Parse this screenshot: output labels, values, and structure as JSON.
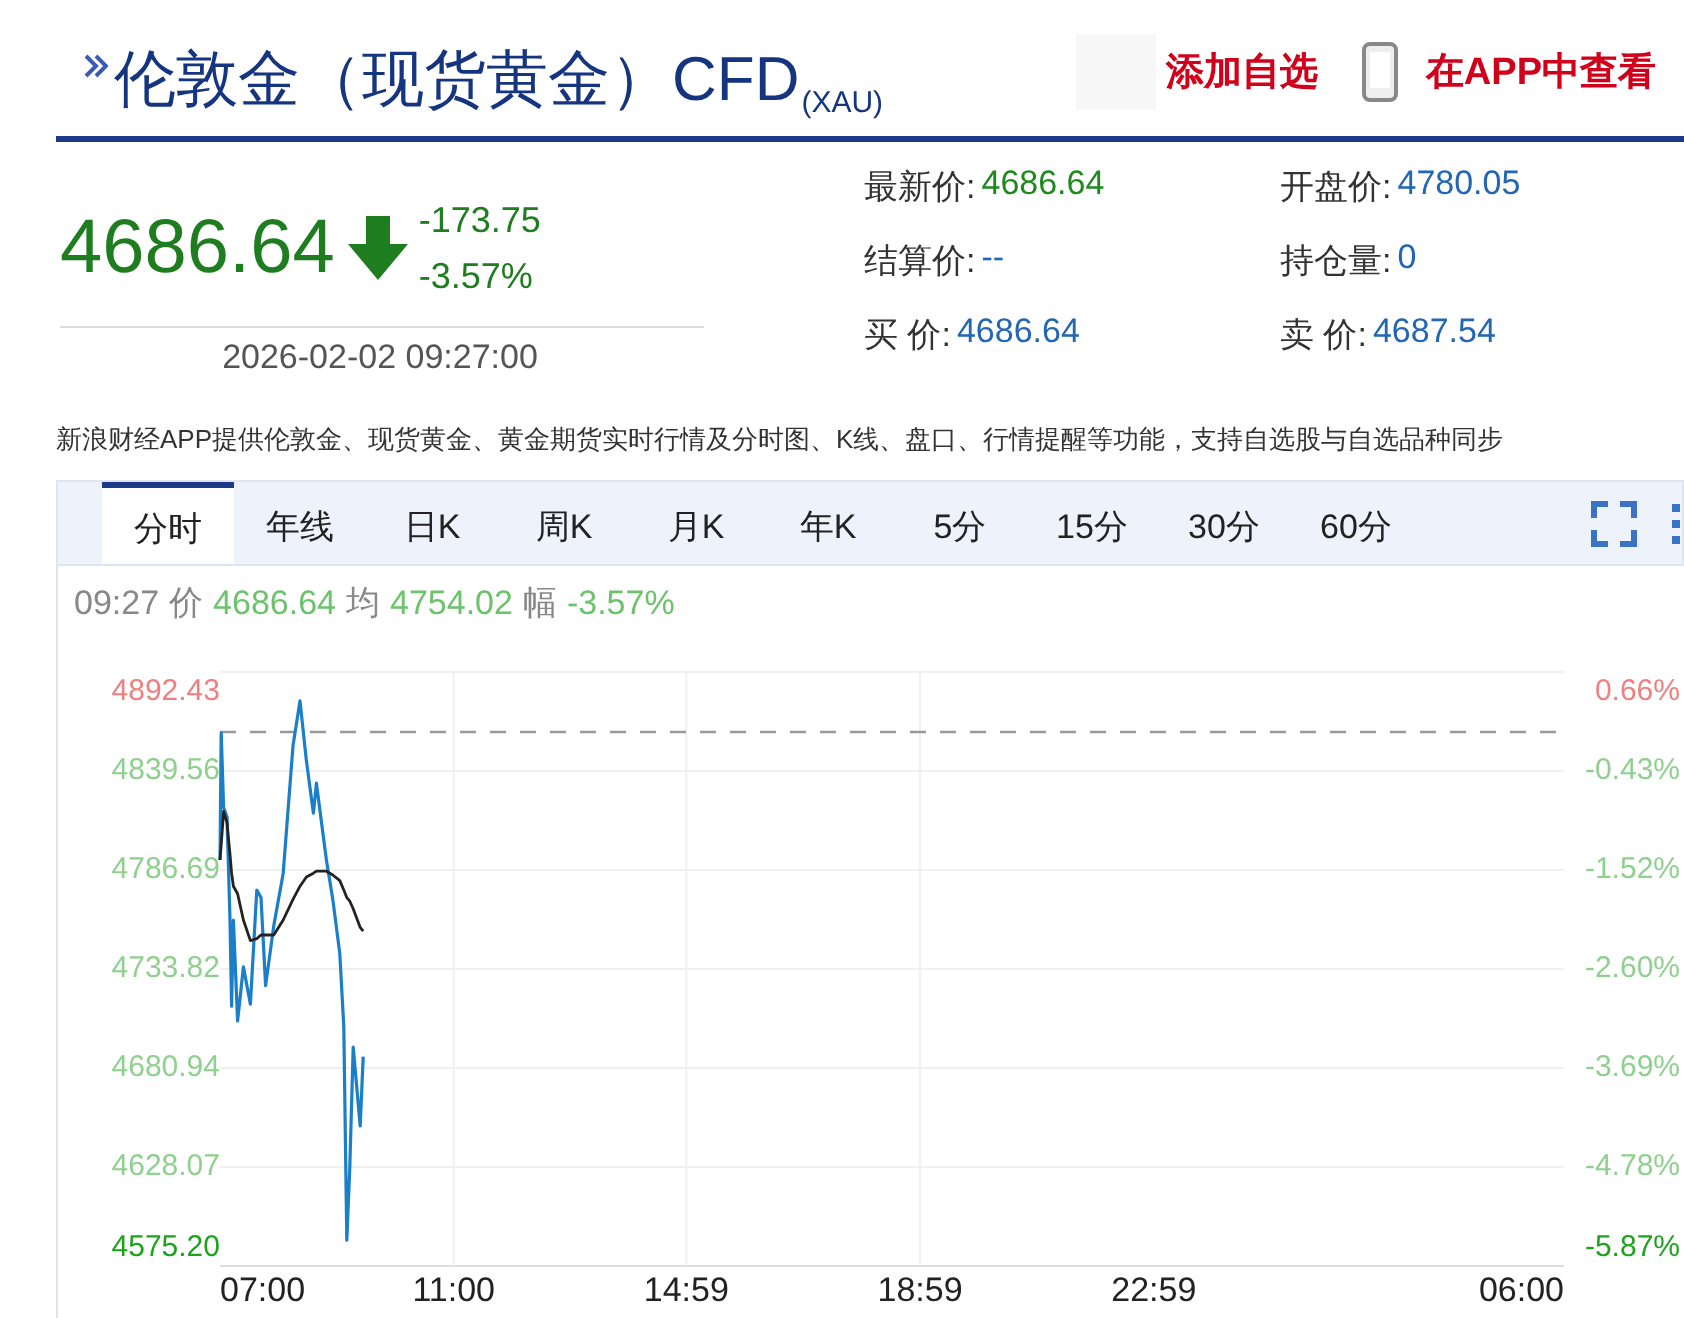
{
  "header": {
    "title": "伦敦金（现货黄金）CFD",
    "code": "(XAU)",
    "actions": [
      {
        "kind": "watch",
        "label": "添加自选"
      },
      {
        "kind": "app",
        "label": "在APP中查看"
      }
    ]
  },
  "quote": {
    "price": "4686.64",
    "change": "-173.75",
    "change_pct": "-3.57%",
    "down": true,
    "time": "2026-02-02 09:27:00"
  },
  "fields": [
    {
      "name": "最新价:",
      "value": "4686.64",
      "color": "#1e8a1e"
    },
    {
      "name": "开盘价:",
      "value": "4780.05",
      "color": "#2366b5"
    },
    {
      "name": "结算价:",
      "value": "--",
      "color": "#2366b5"
    },
    {
      "name": "持仓量:",
      "value": "0",
      "color": "#2366b5"
    },
    {
      "name": "买 价:",
      "value": "4686.64",
      "color": "#2366b5"
    },
    {
      "name": "卖 价:",
      "value": "4687.54",
      "color": "#2366b5"
    }
  ],
  "notice": "新浪财经APP提供伦敦金、现货黄金、黄金期货实时行情及分时图、K线、盘口、行情提醒等功能，支持自选股与自选品种同步",
  "tabs": [
    {
      "label": "分时",
      "selected": true
    },
    {
      "label": "年线",
      "selected": false
    },
    {
      "label": "日K",
      "selected": false
    },
    {
      "label": "周K",
      "selected": false
    },
    {
      "label": "月K",
      "selected": false
    },
    {
      "label": "年K",
      "selected": false
    },
    {
      "label": "5分",
      "selected": false
    },
    {
      "label": "15分",
      "selected": false
    },
    {
      "label": "30分",
      "selected": false
    },
    {
      "label": "60分",
      "selected": false
    }
  ],
  "status": {
    "time": "09:27",
    "items": [
      {
        "label": "价",
        "value": "4686.64"
      },
      {
        "label": "均",
        "value": "4754.02"
      },
      {
        "label": "幅",
        "value": "-3.57%"
      }
    ]
  },
  "chart": {
    "end_label": "06:00",
    "right_labels": [
      "0.66%",
      "-0.43%",
      "-1.52%",
      "-2.60%",
      "-3.69%",
      "-4.78%",
      "-5.87%"
    ],
    "chart_data": {
      "type": "line",
      "x": [
        7,
        7.02,
        7.06,
        7.12,
        7.17,
        7.2,
        7.23,
        7.3,
        7.4,
        7.52,
        7.63,
        7.7,
        7.78,
        7.92,
        8.08,
        8.25,
        8.37,
        8.48,
        8.6,
        8.65,
        8.82,
        8.93,
        9.05,
        9.12,
        9.17,
        9.22,
        9.28,
        9.4,
        9.45
      ],
      "series": [
        {
          "color": "#1a7fc8",
          "values": [
            4792,
            4860,
            4820,
            4815,
            4760,
            4714,
            4760,
            4706,
            4735,
            4715,
            4776,
            4772,
            4725,
            4757,
            4785,
            4853,
            4877,
            4845,
            4817,
            4833,
            4792,
            4771,
            4742,
            4703,
            4589,
            4628,
            4692,
            4650,
            4687
          ]
        },
        {
          "color": "#222222",
          "values": [
            4792,
            4800,
            4818,
            4812,
            4795,
            4785,
            4778,
            4774,
            4760,
            4749,
            4750,
            4752,
            4752,
            4752,
            4760,
            4771,
            4778,
            4783,
            4785,
            4786,
            4786,
            4784,
            4781,
            4776,
            4772,
            4770,
            4766,
            4756,
            4754
          ]
        }
      ],
      "xlim": [
        7,
        30
      ],
      "grid": true,
      "ylim": [
        4575.2,
        4892.43
      ],
      "xticks": [
        {
          "value": 7,
          "label": "07:00"
        },
        {
          "value": 11,
          "label": "11:00"
        },
        {
          "value": 14.98,
          "label": "14:59"
        },
        {
          "value": 18.98,
          "label": "18:59"
        },
        {
          "value": 22.98,
          "label": "22:59"
        }
      ],
      "yticks": [
        4892.43,
        4839.56,
        4786.69,
        4733.82,
        4680.94,
        4628.07,
        {
          "value": 4575.2,
          "label": "4575.20"
        }
      ],
      "ref_lines": [
        {
          "axis": "y",
          "value": 4860.39
        }
      ]
    }
  }
}
